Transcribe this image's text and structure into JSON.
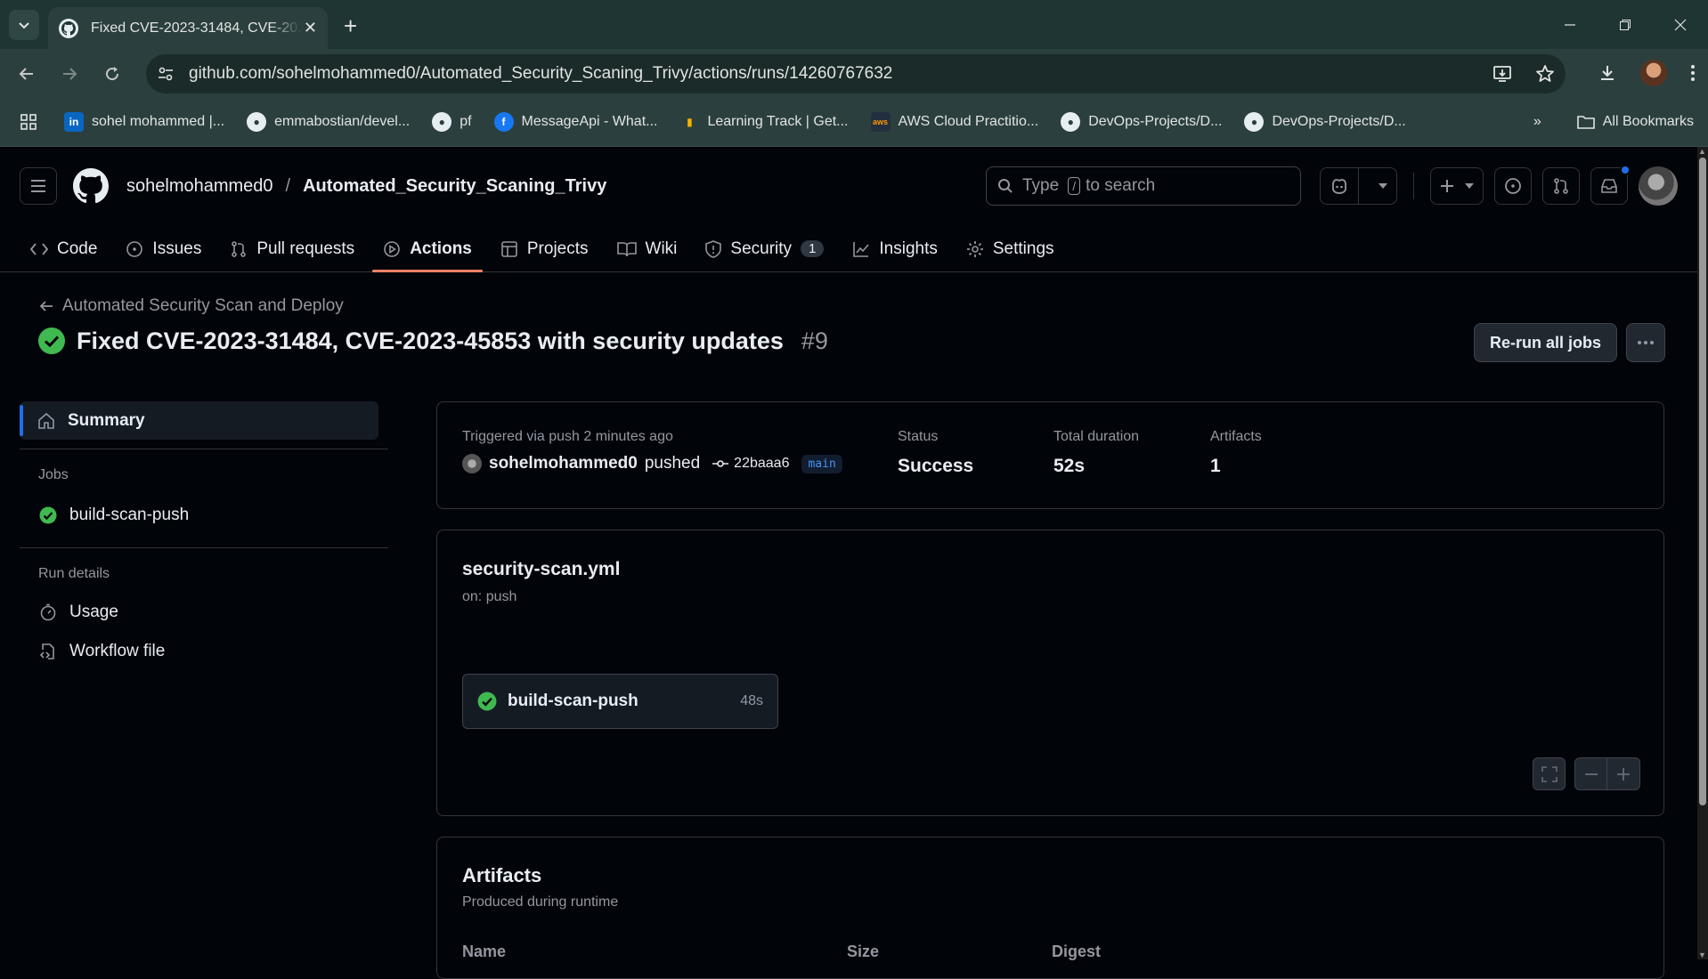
{
  "browser": {
    "tab_title": "Fixed CVE-2023-31484, CVE-2023-45853 with security updates",
    "url": "github.com/sohelmohammed0/Automated_Security_Scaning_Trivy/actions/runs/14260767632",
    "bookmarks": [
      {
        "label": "sohel mohammed |...",
        "icon": "linkedin-icon",
        "color": "#0a66c2"
      },
      {
        "label": "emmabostian/devel...",
        "icon": "github-icon",
        "color": "#e6edf3"
      },
      {
        "label": "pf",
        "icon": "github-icon",
        "color": "#e6edf3"
      },
      {
        "label": "MessageApi - What...",
        "icon": "facebook-icon",
        "color": "#1877f2"
      },
      {
        "label": "Learning Track | Get...",
        "icon": "learning-icon",
        "color": "#f7b500"
      },
      {
        "label": "AWS Cloud Practitio...",
        "icon": "aws-icon",
        "color": "#232f3e"
      },
      {
        "label": "DevOps-Projects/D...",
        "icon": "github-icon",
        "color": "#e6edf3"
      },
      {
        "label": "DevOps-Projects/D...",
        "icon": "github-icon",
        "color": "#e6edf3"
      }
    ],
    "all_bookmarks": "All Bookmarks"
  },
  "header": {
    "owner": "sohelmohammed0",
    "separator": "/",
    "repo": "Automated_Security_Scaning_Trivy",
    "search_prefix": "Type",
    "search_key": "/",
    "search_suffix": "to search"
  },
  "repo_nav": {
    "code": "Code",
    "issues": "Issues",
    "pulls": "Pull requests",
    "actions": "Actions",
    "projects": "Projects",
    "wiki": "Wiki",
    "security": "Security",
    "security_count": "1",
    "insights": "Insights",
    "settings": "Settings"
  },
  "run": {
    "back_label": "Automated Security Scan and Deploy",
    "title": "Fixed CVE-2023-31484, CVE-2023-45853 with security updates",
    "number": "#9",
    "rerun_label": "Re-run all jobs"
  },
  "sidebar": {
    "summary": "Summary",
    "jobs_heading": "Jobs",
    "job": "build-scan-push",
    "run_details_heading": "Run details",
    "usage": "Usage",
    "workflow_file": "Workflow file"
  },
  "summary": {
    "trigger": "Triggered via push 2 minutes ago",
    "actor": "sohelmohammed0",
    "action": "pushed",
    "sha": "22baaa6",
    "branch": "main",
    "status_label": "Status",
    "status_value": "Success",
    "duration_label": "Total duration",
    "duration_value": "52s",
    "artifacts_label": "Artifacts",
    "artifacts_value": "1"
  },
  "workflow": {
    "file": "security-scan.yml",
    "on": "on: push",
    "job_name": "build-scan-push",
    "job_duration": "48s"
  },
  "artifacts": {
    "title": "Artifacts",
    "subtitle": "Produced during runtime",
    "columns": [
      "Name",
      "Size",
      "Digest"
    ]
  },
  "colors": {
    "success": "#3fb950",
    "accent_underline": "#f78166",
    "link_blue": "#4493f8"
  }
}
